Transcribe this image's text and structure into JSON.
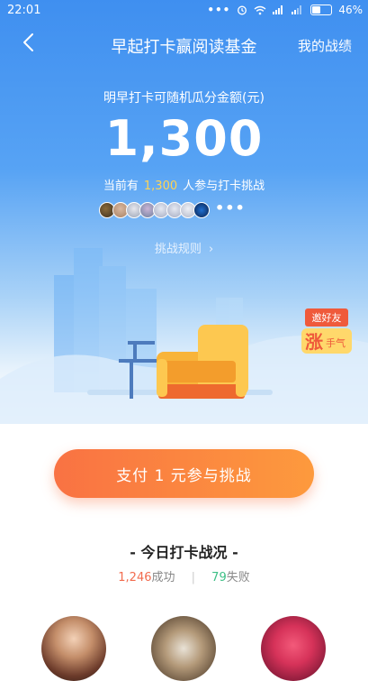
{
  "status_bar": {
    "time": "22:01",
    "dots": "•••",
    "battery": "46%"
  },
  "nav": {
    "title": "早起打卡赢阅读基金",
    "right_link": "我的战绩"
  },
  "hero": {
    "subtitle": "明早打卡可随机瓜分金额(元)",
    "amount": "1,300",
    "participants_prefix": "当前有",
    "participants_count": "1,300",
    "participants_suffix": "人参与打卡挑战",
    "more_avatars": "•••",
    "rules_link": "挑战规则",
    "rules_chevron": "›"
  },
  "invite_badge": {
    "line1": "邀好友",
    "line2_big": "涨",
    "line2_small": "手气"
  },
  "cta": {
    "label": "支付 1 元参与挑战"
  },
  "today": {
    "title": "- 今日打卡战况 -",
    "success_count": "1,246",
    "success_label": "成功",
    "separator": "|",
    "fail_count": "79",
    "fail_label": "失败"
  },
  "colors": {
    "primary_blue": "#3f8ff0",
    "highlight_yellow": "#ffd454",
    "cta_orange": "#f97243",
    "success_red": "#f26b4e",
    "fail_green": "#3dbf86"
  }
}
